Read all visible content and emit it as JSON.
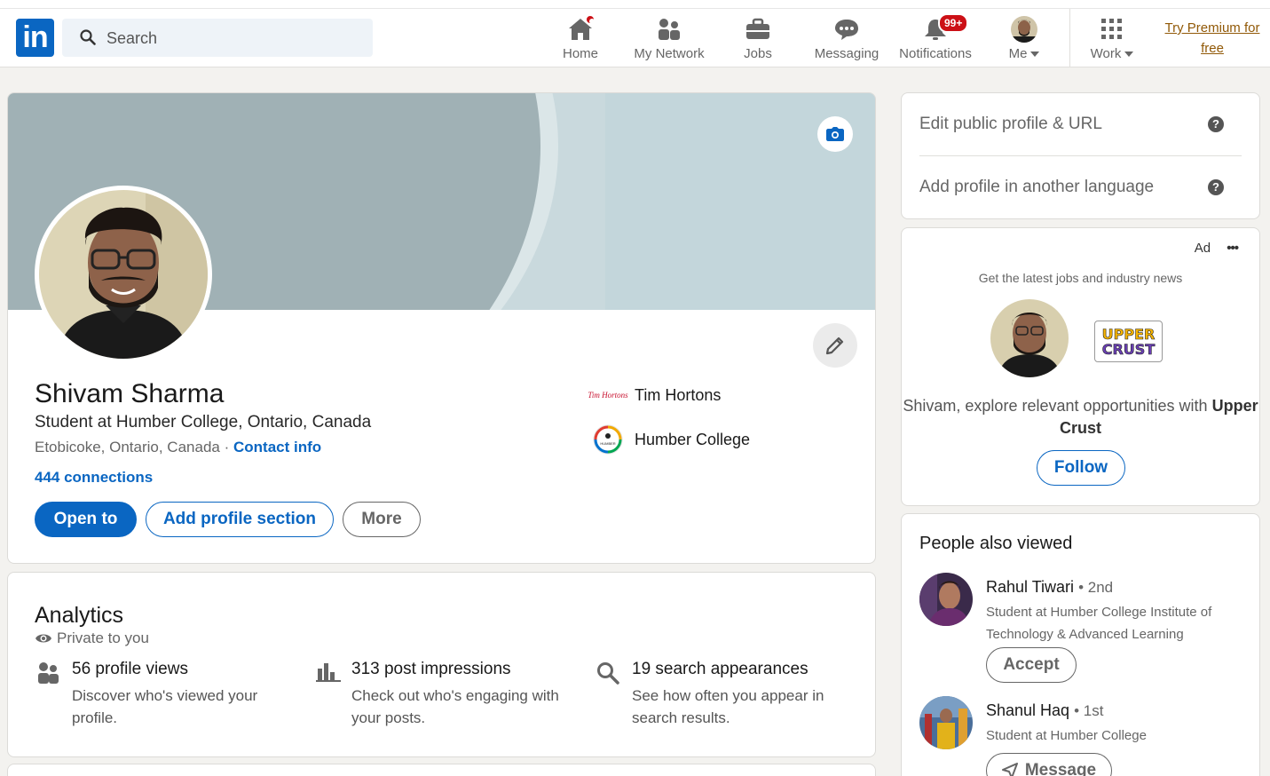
{
  "nav": {
    "search_placeholder": "Search",
    "items": [
      {
        "label": "Home",
        "icon": "home-icon"
      },
      {
        "label": "My Network",
        "icon": "network-icon"
      },
      {
        "label": "Jobs",
        "icon": "briefcase-icon"
      },
      {
        "label": "Messaging",
        "icon": "messaging-icon"
      },
      {
        "label": "Notifications",
        "icon": "bell-icon",
        "badge": "99+"
      },
      {
        "label": "Me",
        "icon": "avatar"
      },
      {
        "label": "Work",
        "icon": "grid-icon"
      }
    ],
    "premium_line1": "Try Premium for",
    "premium_line2": "free"
  },
  "profile": {
    "name": "Shivam Sharma",
    "headline": "Student at Humber College, Ontario, Canada",
    "location": "Etobicoke, Ontario, Canada",
    "separator": "·",
    "contact_info": "Contact info",
    "connections": "444 connections",
    "buttons": {
      "open_to": "Open to",
      "add_section": "Add profile section",
      "more": "More"
    },
    "experience": [
      {
        "name": "Tim Hortons",
        "logo_text": "Tim Hortons"
      },
      {
        "name": "Humber College",
        "logo_text": "HUMBER"
      }
    ]
  },
  "analytics": {
    "title": "Analytics",
    "private": "Private to you",
    "stats": [
      {
        "title": "56 profile views",
        "desc": "Discover who's viewed your profile.",
        "icon": "people-icon"
      },
      {
        "title": "313 post impressions",
        "desc": "Check out who's engaging with your posts.",
        "icon": "bar-chart-icon"
      },
      {
        "title": "19 search appearances",
        "desc": "See how often you appear in search results.",
        "icon": "search-icon"
      }
    ]
  },
  "rail": {
    "edit_public": "Edit public profile & URL",
    "add_language": "Add profile in another language",
    "ad": {
      "label": "Ad",
      "more": "•••",
      "subtitle": "Get the latest jobs and industry news",
      "logo_line1": "UPPER",
      "logo_line2": "CRUST",
      "text_prefix": "Shivam, explore relevant opportunities with",
      "text_company": "Upper Crust",
      "follow": "Follow"
    },
    "people_title": "People also viewed",
    "people": [
      {
        "name": "Rahul Tiwari",
        "degree": "• 2nd",
        "desc": "Student at Humber College Institute of Technology & Advanced Learning",
        "action": "Accept"
      },
      {
        "name": "Shanul Haq",
        "degree": "• 1st",
        "desc": "Student at Humber College",
        "action": "Message"
      }
    ]
  },
  "colors": {
    "brand": "#0a66c2",
    "badge": "#cc1016",
    "premium": "#915907"
  }
}
